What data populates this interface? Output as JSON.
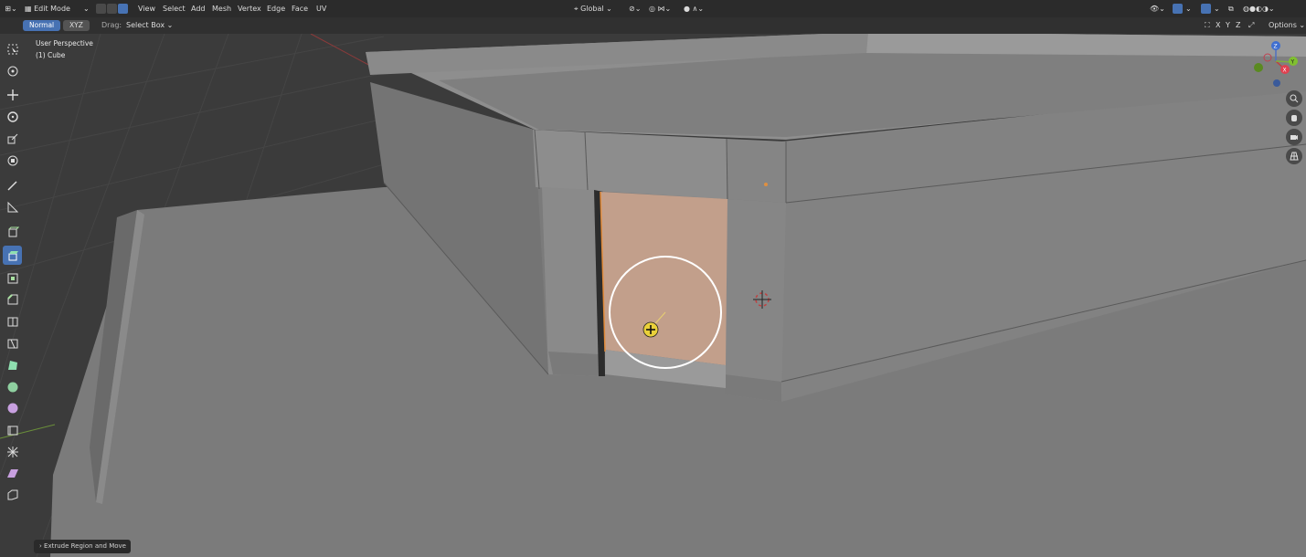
{
  "header": {
    "mode": "Edit Mode",
    "menus": [
      "View",
      "Select",
      "Add",
      "Mesh",
      "Vertex",
      "Edge",
      "Face",
      "UV"
    ],
    "transform_orientation": "Global"
  },
  "tool_header": {
    "orientation_normal": "Normal",
    "orientation_xyz": "XYZ",
    "drag_label": "Drag:",
    "drag_value": "Select Box",
    "axis_x": "X",
    "axis_y": "Y",
    "axis_z": "Z",
    "options": "Options"
  },
  "viewport_info": {
    "perspective": "User Perspective",
    "object": "(1) Cube"
  },
  "gizmo": {
    "x": "X",
    "y": "Y",
    "z": "Z"
  },
  "last_operator": "Extrude Region and Move",
  "colors": {
    "accent": "#4772b3",
    "selected_face": "#c9a08a",
    "background": "#3a3a3a"
  },
  "icons": {
    "toolbar": [
      "select-box-icon",
      "cursor-icon",
      "move-icon",
      "rotate-icon",
      "scale-icon",
      "transform-icon",
      "annotate-icon",
      "measure-icon",
      "add-cube-icon",
      "extrude-region-icon",
      "inset-faces-icon",
      "bevel-icon",
      "loop-cut-icon",
      "knife-icon",
      "poly-build-icon",
      "spin-icon",
      "smooth-icon",
      "edge-slide-icon",
      "shrink-fatten-icon",
      "shear-icon",
      "rip-region-icon"
    ]
  }
}
